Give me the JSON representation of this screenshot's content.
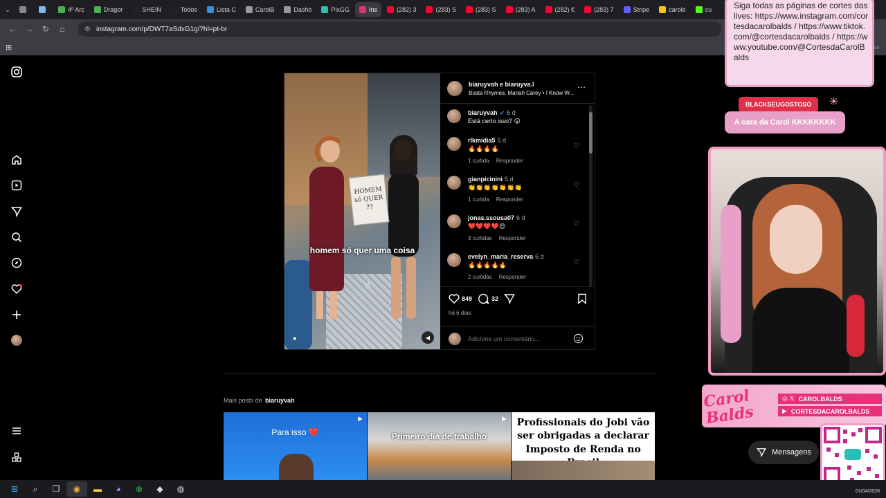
{
  "browser": {
    "tabs": [
      {
        "label": "",
        "icon": "apps-icon"
      },
      {
        "label": "",
        "icon": "gem-icon"
      },
      {
        "label": "4º Arc",
        "icon": "drive-icon"
      },
      {
        "label": "Dragor",
        "icon": "drive-icon"
      },
      {
        "label": "SHEIN",
        "icon": "s-icon"
      },
      {
        "label": "Todos",
        "icon": "s-icon"
      },
      {
        "label": "Lista C",
        "icon": "cloud-icon"
      },
      {
        "label": "CarolB",
        "icon": "globe-icon"
      },
      {
        "label": "Dashb",
        "icon": "globe-icon"
      },
      {
        "label": "PixGG",
        "icon": "pix-icon"
      },
      {
        "label": "Ins",
        "icon": "instagram-icon",
        "active": true
      },
      {
        "label": "(282) 3",
        "icon": "youtube-icon"
      },
      {
        "label": "(283) S",
        "icon": "youtube-icon"
      },
      {
        "label": "(283) S",
        "icon": "youtube-icon"
      },
      {
        "label": "(283) A",
        "icon": "youtube-icon"
      },
      {
        "label": "(282) €",
        "icon": "youtube-icon"
      },
      {
        "label": "(283) 7",
        "icon": "youtube-icon"
      },
      {
        "label": "Stripe",
        "icon": "stripe-icon"
      },
      {
        "label": "carole",
        "icon": "yellow-icon"
      },
      {
        "label": "cu",
        "icon": "k-icon"
      }
    ],
    "url": "instagram.com/p/DWT7aSdxG1g/?hl=pt-br",
    "bookmark_suffix": "os"
  },
  "post": {
    "header_user": "biaruyvah e biaruyva.l",
    "header_music": "Busta Rhymes, Mariah Carey • I Know W...",
    "video_caption": "homem só quer uma coisa",
    "sign_text": "HOMEM só QUER ??",
    "caption_user": "biaruyvah",
    "caption_time": "6 d",
    "caption_text": "Está certo isso? 😮",
    "comments": [
      {
        "user": "rlkmidia5",
        "time": "5 d",
        "text": "🔥🔥🔥🔥",
        "likes": "1 curtida",
        "reply": "Responder"
      },
      {
        "user": "gianpicinini",
        "time": "5 d",
        "text": "👏👏👏👏👏👏👏",
        "likes": "1 curtida",
        "reply": "Responder"
      },
      {
        "user": "jonas.ssousa07",
        "time": "6 d",
        "text": "❤️❤️❤️❤️😍",
        "likes": "3 curtidas",
        "reply": "Responder"
      },
      {
        "user": "evelyn_maria_reserva",
        "time": "6 d",
        "text": "🔥🔥🔥🔥🔥",
        "likes": "2 curtidas",
        "reply": "Responder"
      }
    ],
    "like_count": "849",
    "comment_count": "32",
    "date": "há 6 dias",
    "add_comment_placeholder": "Adicione um comentário..."
  },
  "more_posts": {
    "label": "Mais posts de",
    "user": "biaruyvah",
    "thumbs": [
      {
        "text": "Para isso ❤️"
      },
      {
        "text": "Primeiro dia de trabalho"
      },
      {
        "text": "Profissionais do Jobi vão ser obrigadas a declarar Imposto de Renda no Brasil"
      }
    ]
  },
  "stream_overlay": {
    "info_text": "Siga todas as páginas de cortes das lives: https://www.instagram.com/cortesdacarolbalds / https://www.tiktok.com/@cortesdacarolbalds / https://www.youtube.com/@CortesdaCarolBalds",
    "chat_user": "BLACKSEUGOSTOSO",
    "chat_msg": "A cara da Carol KKKKKKKK",
    "brand_logo": "Carol Balds",
    "social_handle_1": "CAROLBALDS",
    "social_handle_2": "CORTESDACAROLBALDS",
    "messages_label": "Mensagens"
  },
  "taskbar": {
    "date": "01/04/2026"
  },
  "colors": {
    "accent_pink": "#e8a0c8",
    "chat_red": "#e0304a",
    "ig_bg": "#000000"
  }
}
